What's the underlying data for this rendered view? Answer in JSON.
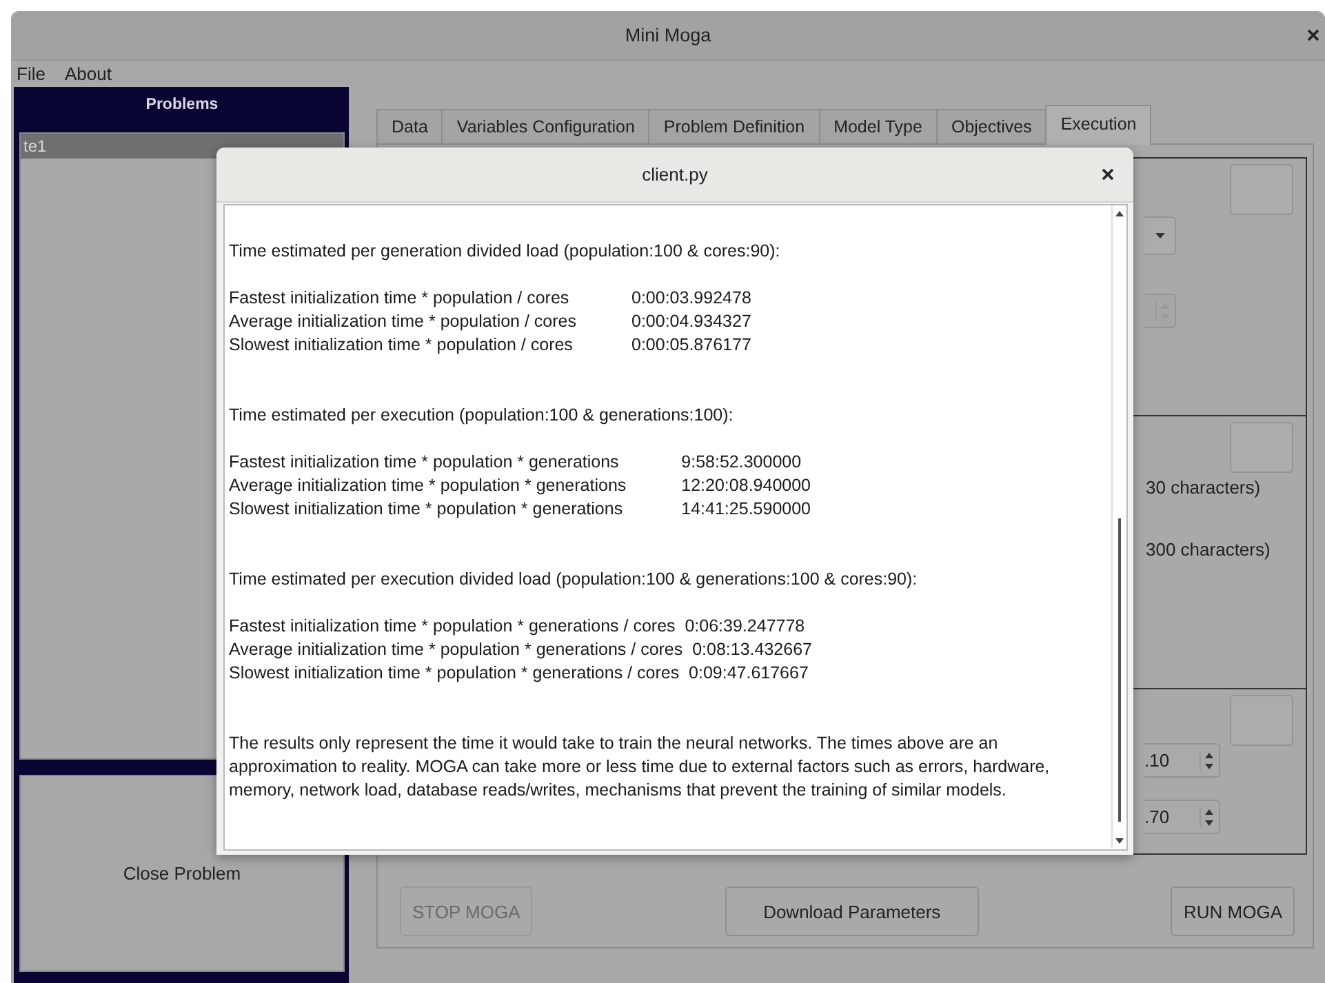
{
  "window": {
    "title": "Mini Moga"
  },
  "menu": [
    "File",
    "About"
  ],
  "problems": {
    "title": "Problems",
    "items": [
      {
        "label": "te1",
        "selected": true
      }
    ],
    "close_button": "Close Problem"
  },
  "tabs": [
    {
      "label": "Data",
      "selected": false
    },
    {
      "label": "Variables Configuration",
      "selected": false
    },
    {
      "label": "Problem Definition",
      "selected": false
    },
    {
      "label": "Model Type",
      "selected": false
    },
    {
      "label": "Objectives",
      "selected": false
    },
    {
      "label": "Execution",
      "selected": true
    }
  ],
  "sections": [
    {
      "items": [
        {
          "kind": "dropdown"
        },
        {
          "kind": "spinbox",
          "disabled": true
        }
      ]
    },
    {
      "items": [
        {
          "kind": "note",
          "text": "30 characters)"
        },
        {
          "kind": "note",
          "text": "300 characters)"
        }
      ]
    },
    {
      "items": [
        {
          "kind": "spinbox",
          "value": ".10",
          "disabled": false
        },
        {
          "kind": "spinbox",
          "value": ".70",
          "disabled": false
        }
      ]
    }
  ],
  "buttons": [
    {
      "label": "STOP MOGA",
      "disabled": true
    },
    {
      "label": "Download Parameters",
      "disabled": false
    },
    {
      "label": "RUN MOGA",
      "disabled": false
    }
  ],
  "dialog": {
    "title": "client.py",
    "blocks": [
      {
        "kind": "heading",
        "text": "Time estimated per generation divided load (population:100 & cores:90):"
      },
      {
        "kind": "table",
        "rows": [
          {
            "label": "Fastest initialization time * population / cores",
            "value": "0:00:03.992478"
          },
          {
            "label": "Average initialization time * population / cores",
            "value": "0:00:04.934327"
          },
          {
            "label": "Slowest initialization time * population / cores",
            "value": "0:00:05.876177"
          }
        ]
      },
      {
        "kind": "heading",
        "text": "Time estimated per execution (population:100 & generations:100):"
      },
      {
        "kind": "table",
        "rows": [
          {
            "label": "Fastest initialization time * population * generations",
            "value": "9:58:52.300000"
          },
          {
            "label": "Average initialization time * population * generations",
            "value": "12:20:08.940000"
          },
          {
            "label": "Slowest initialization time * population * generations",
            "value": "14:41:25.590000"
          }
        ]
      },
      {
        "kind": "heading",
        "text": "Time estimated per execution divided load (population:100 & generations:100 & cores:90):"
      },
      {
        "kind": "lines",
        "lines": [
          "Fastest initialization time * population * generations / cores  0:06:39.247778",
          "Average initialization time * population * generations / cores  0:08:13.432667",
          "Slowest initialization time * population * generations / cores  0:09:47.617667"
        ]
      },
      {
        "kind": "paragraph",
        "text": "The results only represent the time it would take to train the neural networks. The times above are an approximation to reality. MOGA can take more or less time due to external factors such as errors, hardware, memory, network load, database reads/writes, mechanisms that prevent the training of similar models."
      }
    ]
  }
}
